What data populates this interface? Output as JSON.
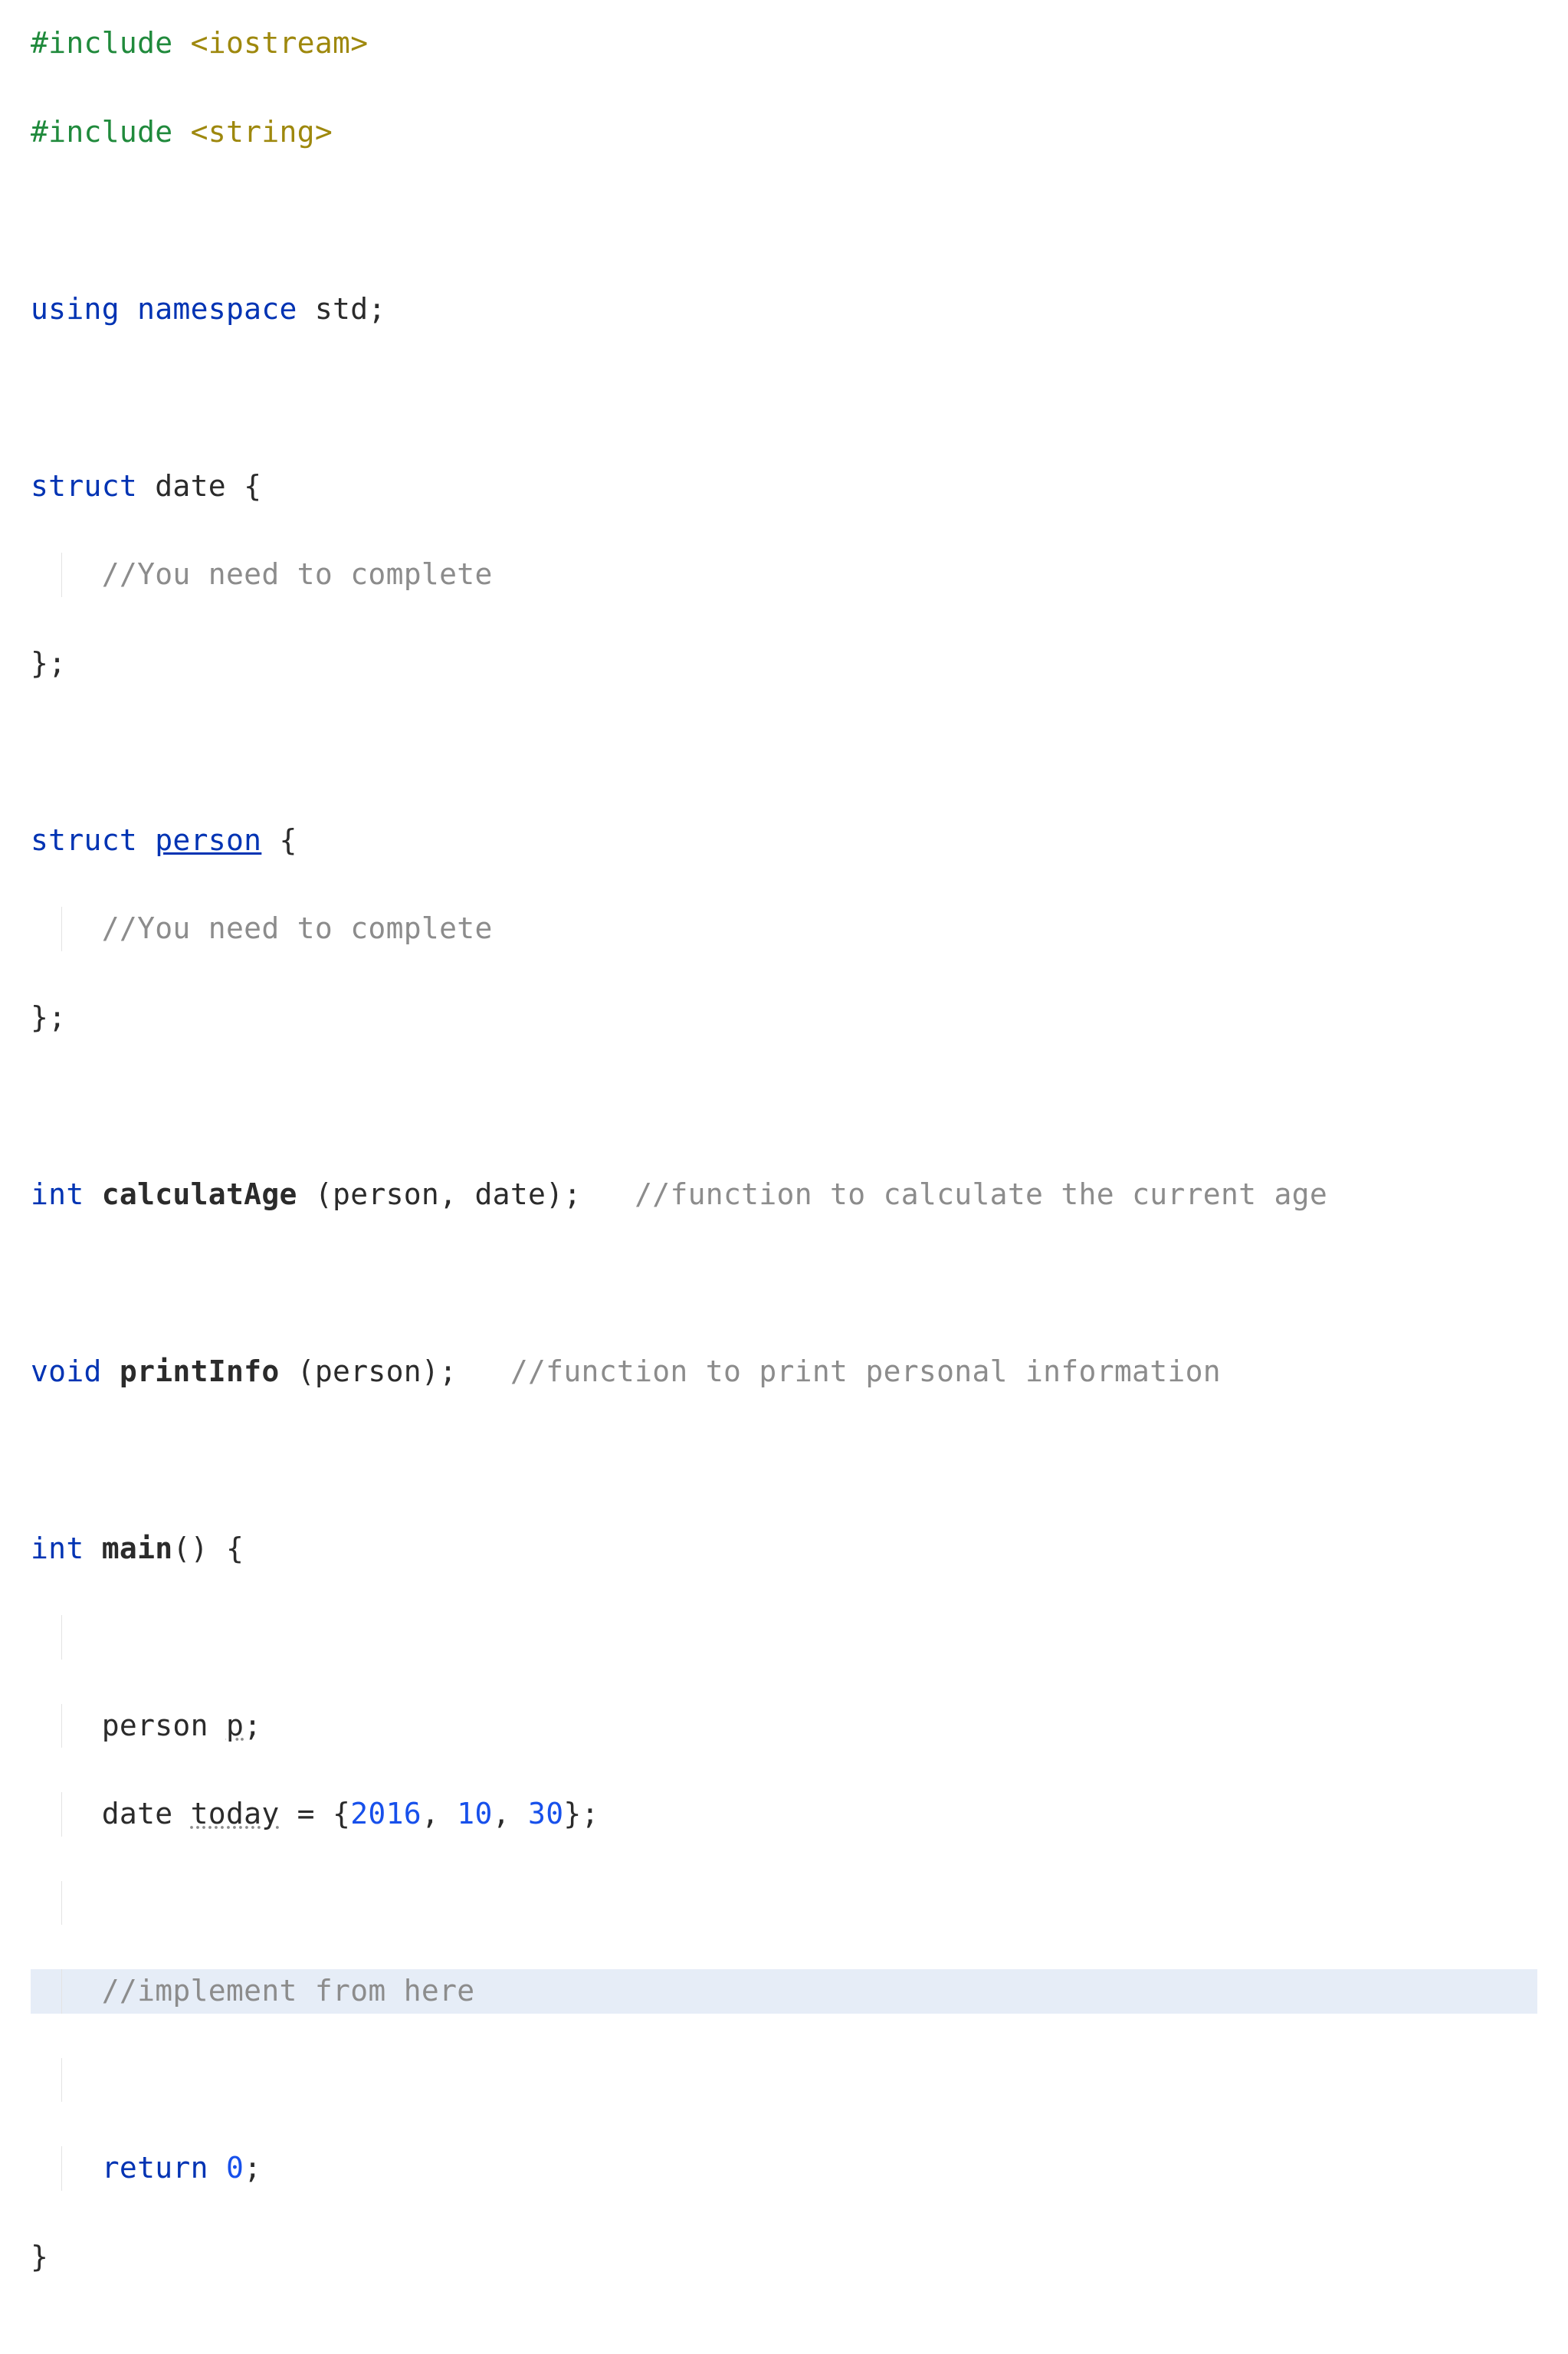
{
  "colors": {
    "directive": "#208a3c",
    "header": "#9e880d",
    "keyword": "#0033b3",
    "comment": "#8c8c8c",
    "number": "#1750eb",
    "highlight_bg": "#e6edf7"
  },
  "code": {
    "line1": {
      "directive": "#include ",
      "header": "<iostream>"
    },
    "line2": {
      "directive": "#include ",
      "header": "<string>"
    },
    "line4": {
      "kw1": "using ",
      "kw2": "namespace ",
      "ident": "std",
      "end": ";"
    },
    "line6": {
      "kw": "struct ",
      "name": "date",
      "open": " {"
    },
    "line7": {
      "indent": "    ",
      "comment": "//You need to complete"
    },
    "line8": {
      "close": "};"
    },
    "line10": {
      "kw": "struct ",
      "name": "person",
      "open": " {"
    },
    "line11": {
      "indent": "    ",
      "comment": "//You need to complete"
    },
    "line12": {
      "close": "};"
    },
    "line14": {
      "kw": "int ",
      "fn": "calculatAge",
      "args": " (person, date);",
      "pad": "   ",
      "comment": "//function to calculate the current age"
    },
    "line16": {
      "kw": "void ",
      "fn": "printInfo",
      "args": " (person);",
      "pad": "   ",
      "comment": "//function to print personal information"
    },
    "line18": {
      "kw": "int ",
      "fn": "main",
      "args": "() {"
    },
    "line20": {
      "indent": "    ",
      "text_a": "person ",
      "var": "p",
      "text_b": ";"
    },
    "line21": {
      "indent": "    ",
      "text_a": "date ",
      "var": "today",
      "text_b": " = {",
      "n1": "2016",
      "c1": ", ",
      "n2": "10",
      "c2": ", ",
      "n3": "30",
      "text_c": "};"
    },
    "line23": {
      "indent": "    ",
      "comment": "//implement from here"
    },
    "line25": {
      "indent": "    ",
      "kw": "return ",
      "n": "0",
      "end": ";"
    },
    "line26": {
      "close": "}"
    }
  }
}
